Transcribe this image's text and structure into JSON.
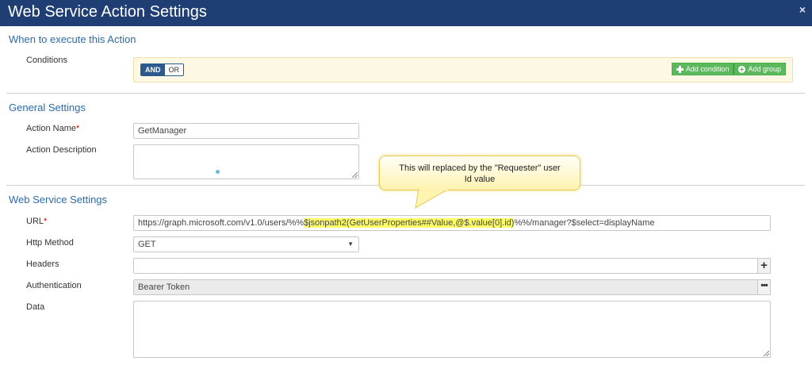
{
  "window": {
    "title": "Web Service Action Settings",
    "close_glyph": "×"
  },
  "when_section": {
    "title": "When to execute this Action",
    "conditions_label": "Conditions",
    "toggle": {
      "and_label": "AND",
      "or_label": "OR",
      "active": "AND"
    },
    "add_condition_label": "Add condition",
    "add_group_label": "Add group"
  },
  "general_section": {
    "title": "General Settings",
    "action_name_label": "Action Name",
    "required_mark": "*",
    "action_name_value": "GetManager",
    "action_description_label": "Action Description",
    "action_description_value": ""
  },
  "ws_section": {
    "title": "Web Service Settings",
    "url_label": "URL",
    "required_mark": "*",
    "url_prefix": "https://graph.microsoft.com/v1.0/users/%%",
    "url_highlight": "$jsonpath2(GetUserProperties##Value,@$.value[0].id)",
    "url_suffix": "%%/manager?$select=displayName",
    "http_method_label": "Http Method",
    "http_method_value": "GET",
    "headers_label": "Headers",
    "headers_value": "",
    "add_header_glyph": "+",
    "authentication_label": "Authentication",
    "authentication_value": "Bearer Token",
    "auth_more_glyph": "•••",
    "data_label": "Data",
    "data_value": ""
  },
  "callout": {
    "line1": "This will replaced by the \"Requester\" user",
    "line2": "Id value"
  },
  "colors": {
    "titlebar": "#1f3f74",
    "section_title": "#2d6ba8",
    "green_button": "#5cb85c",
    "highlight": "#ffff66",
    "callout_fill": "#fff3b0"
  }
}
